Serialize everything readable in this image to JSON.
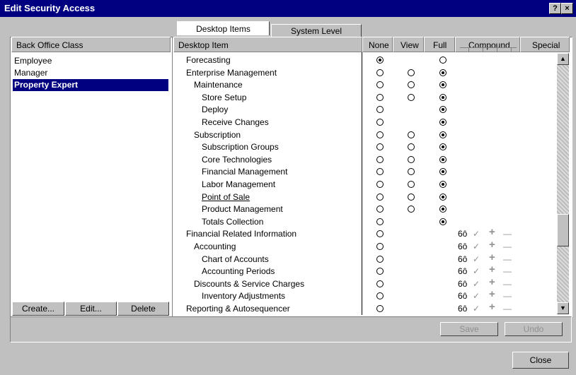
{
  "window": {
    "title": "Edit Security Access",
    "help_label": "?",
    "close_label": "×"
  },
  "left_panel": {
    "header": "Back Office Class",
    "items": [
      "Employee",
      "Manager",
      "Property Expert"
    ],
    "selected": "Property Expert",
    "buttons": {
      "create": "Create...",
      "edit": "Edit...",
      "delete": "Delete"
    }
  },
  "tabs": [
    {
      "label": "Desktop Items",
      "active": true
    },
    {
      "label": "System Level",
      "active": false
    }
  ],
  "grid": {
    "columns": {
      "item": "Desktop Item",
      "none": "None",
      "view": "View",
      "full": "Full",
      "compound": "Compound",
      "special": "Special"
    },
    "rows": [
      {
        "label": "Forecasting",
        "indent": 0,
        "none": "on",
        "view": "",
        "full": "off",
        "compound": false
      },
      {
        "label": "Enterprise Management",
        "indent": 0,
        "none": "off",
        "view": "off",
        "full": "on",
        "compound": false
      },
      {
        "label": "Maintenance",
        "indent": 1,
        "none": "off",
        "view": "off",
        "full": "on",
        "compound": false
      },
      {
        "label": "Store Setup",
        "indent": 2,
        "none": "off",
        "view": "off",
        "full": "on",
        "compound": false
      },
      {
        "label": "Deploy",
        "indent": 2,
        "none": "off",
        "view": "",
        "full": "on",
        "compound": false
      },
      {
        "label": "Receive Changes",
        "indent": 2,
        "none": "off",
        "view": "",
        "full": "on",
        "compound": false
      },
      {
        "label": "Subscription",
        "indent": 1,
        "none": "off",
        "view": "off",
        "full": "on",
        "compound": false
      },
      {
        "label": "Subscription Groups",
        "indent": 2,
        "none": "off",
        "view": "off",
        "full": "on",
        "compound": false
      },
      {
        "label": "Core Technologies",
        "indent": 2,
        "none": "off",
        "view": "off",
        "full": "on",
        "compound": false
      },
      {
        "label": "Financial Management",
        "indent": 2,
        "none": "off",
        "view": "off",
        "full": "on",
        "compound": false
      },
      {
        "label": "Labor Management",
        "indent": 2,
        "none": "off",
        "view": "off",
        "full": "on",
        "compound": false
      },
      {
        "label": "Point of Sale",
        "indent": 2,
        "none": "off",
        "view": "off",
        "full": "on",
        "compound": false,
        "underline": true
      },
      {
        "label": "Product Management",
        "indent": 2,
        "none": "off",
        "view": "off",
        "full": "on",
        "compound": false
      },
      {
        "label": "Totals Collection",
        "indent": 2,
        "none": "off",
        "view": "",
        "full": "on",
        "compound": false
      },
      {
        "label": "Financial Related Information",
        "indent": 0,
        "none": "off",
        "view": "",
        "full": "",
        "compound": true
      },
      {
        "label": "Accounting",
        "indent": 1,
        "none": "off",
        "view": "",
        "full": "",
        "compound": true
      },
      {
        "label": "Chart of Accounts",
        "indent": 2,
        "none": "off",
        "view": "",
        "full": "",
        "compound": true
      },
      {
        "label": "Accounting Periods",
        "indent": 2,
        "none": "off",
        "view": "",
        "full": "",
        "compound": true
      },
      {
        "label": "Discounts & Service Charges",
        "indent": 1,
        "none": "off",
        "view": "",
        "full": "",
        "compound": true
      },
      {
        "label": "Inventory Adjustments",
        "indent": 2,
        "none": "off",
        "view": "",
        "full": "",
        "compound": true
      },
      {
        "label": "Reporting & Autosequencer",
        "indent": 0,
        "none": "off",
        "view": "",
        "full": "",
        "compound": true
      }
    ],
    "compound_glyphs": {
      "view": "6ô",
      "check": "✓",
      "plus": "+",
      "minus": "—"
    }
  },
  "actions": {
    "save": "Save",
    "undo": "Undo",
    "close": "Close"
  },
  "scroll": {
    "up_arrow": "▲",
    "down_arrow": "▼"
  }
}
